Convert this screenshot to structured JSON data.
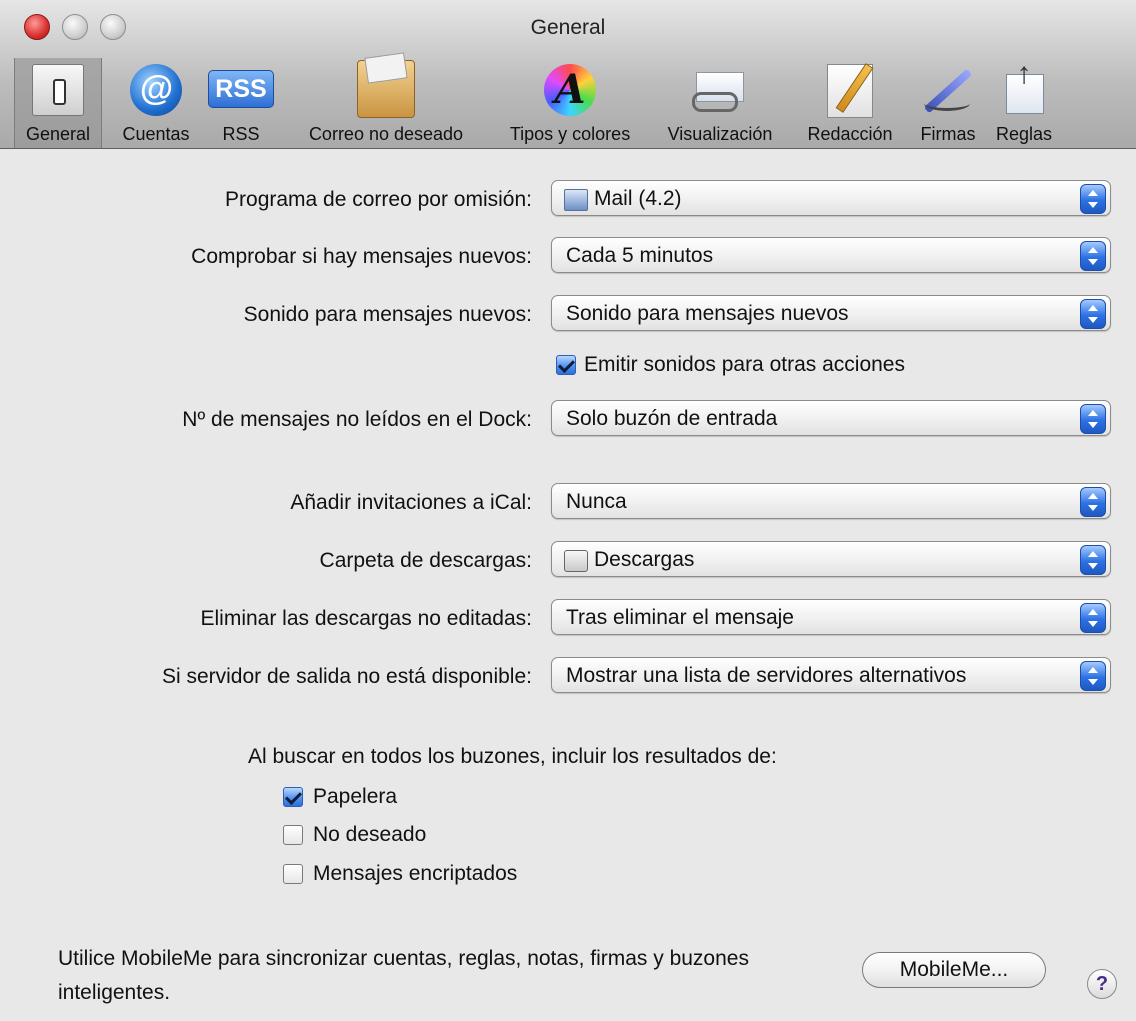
{
  "window": {
    "title": "General"
  },
  "toolbar": {
    "items": [
      {
        "label": "General",
        "icon": "general-icon",
        "selected": true
      },
      {
        "label": "Cuentas",
        "icon": "at-sign-icon"
      },
      {
        "label": "RSS",
        "icon": "rss-icon",
        "icon_text": "RSS"
      },
      {
        "label": "Correo no deseado",
        "icon": "junk-mail-icon"
      },
      {
        "label": "Tipos y colores",
        "icon": "fonts-and-colors-icon",
        "icon_text": "A"
      },
      {
        "label": "Visualización",
        "icon": "viewing-icon"
      },
      {
        "label": "Redacción",
        "icon": "composing-icon"
      },
      {
        "label": "Firmas",
        "icon": "signatures-icon"
      },
      {
        "label": "Reglas",
        "icon": "rules-icon"
      }
    ]
  },
  "settings": {
    "default_mail_reader": {
      "label": "Programa de correo por omisión:",
      "value": "Mail (4.2)",
      "icon": "mail-app-icon"
    },
    "check_new_mail": {
      "label": "Comprobar si hay mensajes nuevos:",
      "value": "Cada 5 minutos"
    },
    "new_mail_sound": {
      "label": "Sonido para mensajes nuevos:",
      "value": "Sonido para mensajes nuevos"
    },
    "other_sounds": {
      "label": "Emitir sonidos para otras acciones",
      "checked": true
    },
    "dock_unread": {
      "label": "Nº de mensajes no leídos en el Dock:",
      "value": "Solo buzón de entrada"
    },
    "ical_invites": {
      "label": "Añadir invitaciones a iCal:",
      "value": "Nunca"
    },
    "downloads_folder": {
      "label": "Carpeta de descargas:",
      "value": "Descargas",
      "icon": "downloads-folder-icon"
    },
    "remove_downloads": {
      "label": "Eliminar las descargas no editadas:",
      "value": "Tras eliminar el mensaje"
    },
    "outgoing_unavailable": {
      "label": "Si servidor de salida no está disponible:",
      "value": "Mostrar una lista de servidores alternativos"
    }
  },
  "search": {
    "heading": "Al buscar en todos los buzones, incluir los resultados de:",
    "options": [
      {
        "label": "Papelera",
        "checked": true
      },
      {
        "label": "No deseado",
        "checked": false
      },
      {
        "label": "Mensajes encriptados",
        "checked": false
      }
    ]
  },
  "footer": {
    "text": "Utilice MobileMe para sincronizar cuentas, reglas, notas, firmas y buzones inteligentes.",
    "button_label": "MobileMe...",
    "help_label": "?"
  },
  "colors": {
    "accent": "#2c71e4",
    "close_button": "#d8302b"
  }
}
